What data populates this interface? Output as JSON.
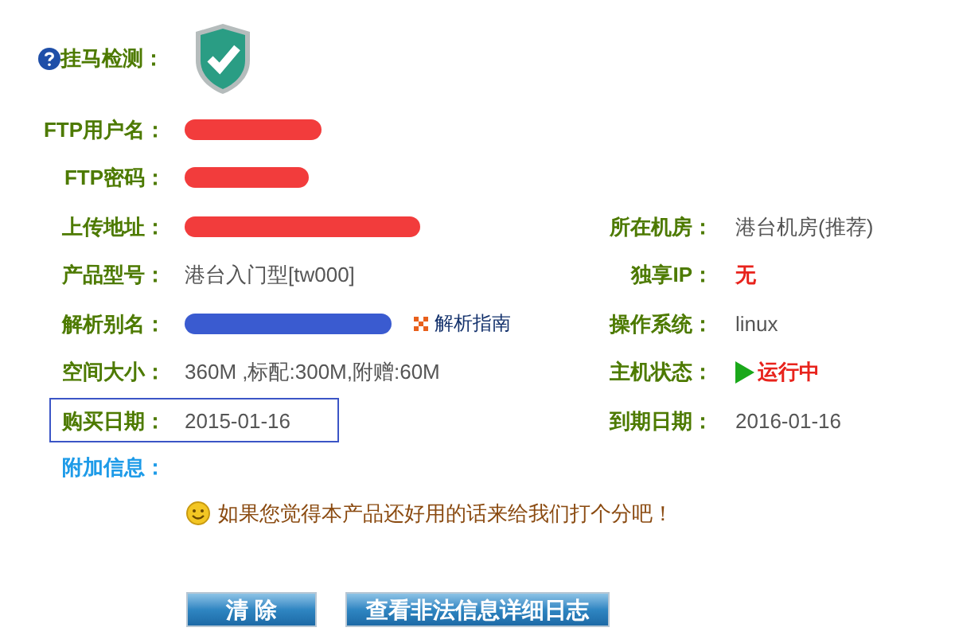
{
  "detection": {
    "label": "挂马检测："
  },
  "rows": [
    {
      "left": {
        "label": "FTP用户名：",
        "kind": "redacted",
        "color": "#f23c3c"
      }
    },
    {
      "left": {
        "label": "FTP密码：",
        "kind": "redacted",
        "color": "#f23c3c"
      }
    },
    {
      "left": {
        "label": "上传地址：",
        "kind": "redacted",
        "color": "#f23c3c"
      },
      "right": {
        "label": "所在机房：",
        "kind": "text",
        "value": "港台机房(推荐)"
      }
    },
    {
      "left": {
        "label": "产品型号：",
        "kind": "text",
        "value": "港台入门型[tw000]"
      },
      "right": {
        "label": "独享IP：",
        "kind": "alert",
        "value": "无"
      }
    },
    {
      "left": {
        "label": "解析别名：",
        "kind": "redacted",
        "color": "#3a5bd0",
        "link": "解析指南"
      },
      "right": {
        "label": "操作系统：",
        "kind": "text",
        "value": "linux"
      }
    },
    {
      "left": {
        "label": "空间大小：",
        "kind": "text",
        "value": "360M ,标配:300M,附赠:60M"
      },
      "right": {
        "label": "主机状态：",
        "kind": "status",
        "value": "运行中"
      }
    },
    {
      "left": {
        "label": "购买日期：",
        "kind": "outlined",
        "value": "2015-01-16"
      },
      "right": {
        "label": "到期日期：",
        "kind": "text",
        "value": "2016-01-16"
      }
    }
  ],
  "extra_info": {
    "label": "附加信息："
  },
  "rating_prompt": "如果您觉得本产品还好用的话来给我们打个分吧！",
  "buttons": [
    "清 除",
    "查看非法信息详细日志"
  ]
}
